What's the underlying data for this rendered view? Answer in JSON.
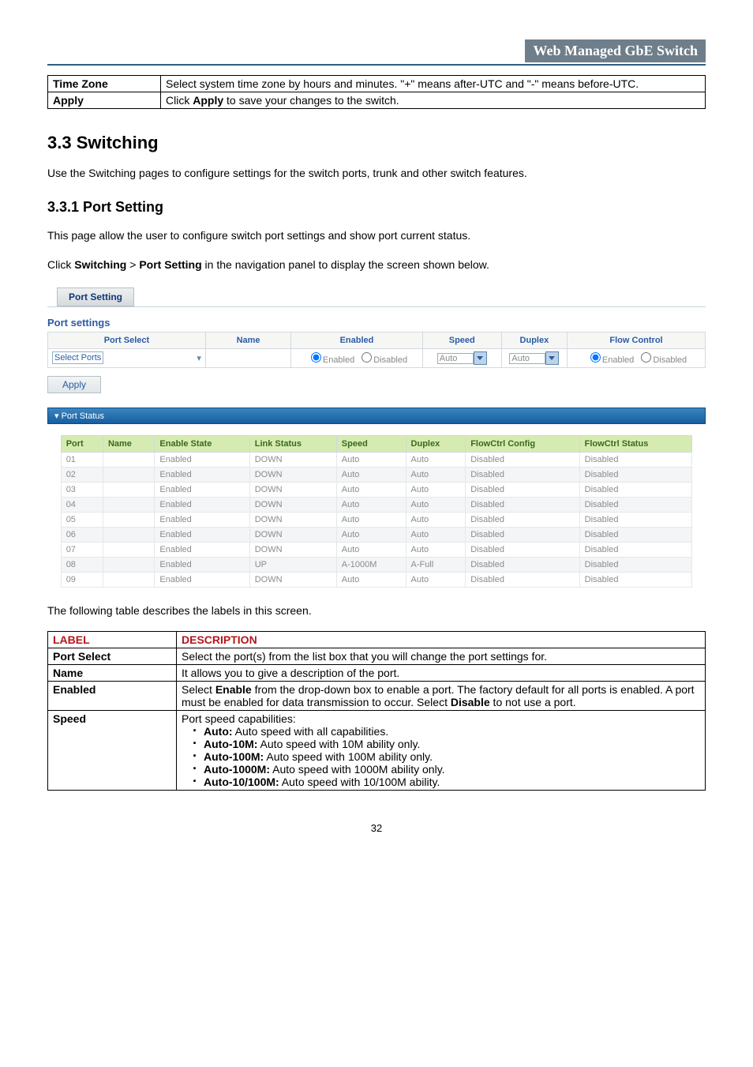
{
  "header": {
    "title": "Web Managed GbE Switch"
  },
  "top_table": [
    {
      "label": "Time Zone",
      "desc_plain": "Select system time zone by hours and minutes. \"+\" means after-UTC and \"-\" means before-UTC."
    },
    {
      "label": "Apply",
      "desc_prefix": "Click ",
      "desc_bold": "Apply",
      "desc_suffix": " to save your changes to the switch."
    }
  ],
  "section": {
    "h2": "3.3 Switching",
    "p1": "Use the Switching pages to configure settings for the switch ports, trunk and other switch features.",
    "h3": "3.3.1 Port Setting",
    "p2": "This page allow the user to configure switch port settings and show port current status.",
    "p3_prefix": "Click ",
    "p3_b1": "Switching",
    "p3_mid": " > ",
    "p3_b2": "Port Setting",
    "p3_suffix": " in the navigation panel to display the screen shown below."
  },
  "ui": {
    "tab": "Port Setting",
    "settings_title": "Port settings",
    "headers": {
      "port_select": "Port Select",
      "name": "Name",
      "enabled": "Enabled",
      "speed": "Speed",
      "duplex": "Duplex",
      "flow": "Flow Control"
    },
    "row": {
      "select_ports": "Select Ports",
      "enabled_on": "Enabled",
      "enabled_off": "Disabled",
      "speed": "Auto",
      "duplex": "Auto",
      "flow_on": "Enabled",
      "flow_off": "Disabled"
    },
    "apply": "Apply",
    "status_title": "Port Status",
    "status_headers": [
      "Port",
      "Name",
      "Enable State",
      "Link Status",
      "Speed",
      "Duplex",
      "FlowCtrl Config",
      "FlowCtrl Status"
    ],
    "status_rows": [
      [
        "01",
        "",
        "Enabled",
        "DOWN",
        "Auto",
        "Auto",
        "Disabled",
        "Disabled"
      ],
      [
        "02",
        "",
        "Enabled",
        "DOWN",
        "Auto",
        "Auto",
        "Disabled",
        "Disabled"
      ],
      [
        "03",
        "",
        "Enabled",
        "DOWN",
        "Auto",
        "Auto",
        "Disabled",
        "Disabled"
      ],
      [
        "04",
        "",
        "Enabled",
        "DOWN",
        "Auto",
        "Auto",
        "Disabled",
        "Disabled"
      ],
      [
        "05",
        "",
        "Enabled",
        "DOWN",
        "Auto",
        "Auto",
        "Disabled",
        "Disabled"
      ],
      [
        "06",
        "",
        "Enabled",
        "DOWN",
        "Auto",
        "Auto",
        "Disabled",
        "Disabled"
      ],
      [
        "07",
        "",
        "Enabled",
        "DOWN",
        "Auto",
        "Auto",
        "Disabled",
        "Disabled"
      ],
      [
        "08",
        "",
        "Enabled",
        "UP",
        "A-1000M",
        "A-Full",
        "Disabled",
        "Disabled"
      ],
      [
        "09",
        "",
        "Enabled",
        "DOWN",
        "Auto",
        "Auto",
        "Disabled",
        "Disabled"
      ]
    ]
  },
  "after_ui": "The following table describes the labels in this screen.",
  "desc_table": {
    "h_label": "LABEL",
    "h_desc": "DESCRIPTION",
    "rows": {
      "port_select": {
        "label": "Port Select",
        "desc": "Select the port(s) from the list box that you will change the port settings for."
      },
      "name": {
        "label": "Name",
        "desc": "It allows you to give a description of the port."
      },
      "enabled": {
        "label": "Enabled",
        "pre": "Select ",
        "b1": "Enable",
        "mid": " from the drop-down box to enable a port. The factory default for all ports is enabled. A port must be enabled for data transmission to occur. Select ",
        "b2": "Disable",
        "post": " to not use a port."
      },
      "speed": {
        "label": "Speed",
        "intro": "Port speed capabilities:",
        "items": [
          {
            "b": "Auto:",
            "t": " Auto speed with all capabilities."
          },
          {
            "b": "Auto-10M:",
            "t": " Auto speed with 10M ability only."
          },
          {
            "b": "Auto-100M:",
            "t": " Auto speed with 100M ability only."
          },
          {
            "b": "Auto-1000M:",
            "t": " Auto speed with 1000M ability only."
          },
          {
            "b": "Auto-10/100M:",
            "t": " Auto speed with 10/100M ability."
          }
        ]
      }
    }
  },
  "page_number": "32"
}
